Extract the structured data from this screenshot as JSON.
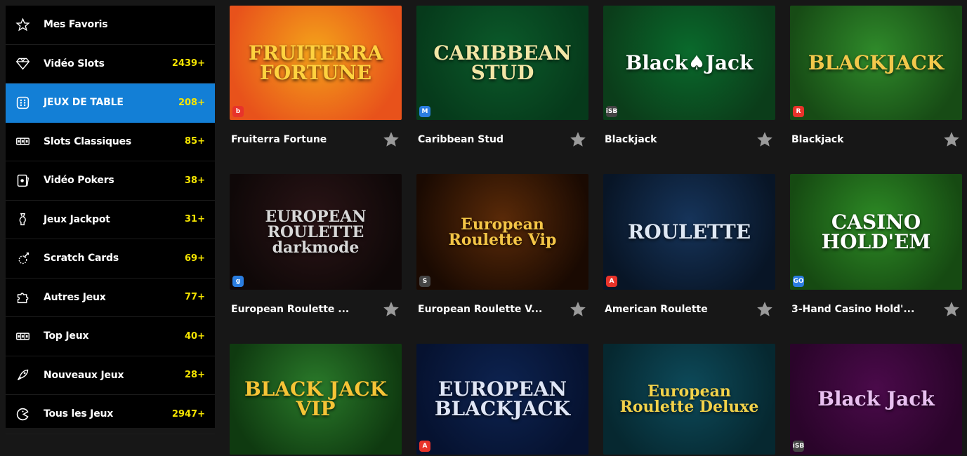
{
  "sidebar": {
    "items": [
      {
        "icon": "star-outline-icon",
        "label": "Mes Favoris",
        "count": ""
      },
      {
        "icon": "diamond-icon",
        "label": "Vidéo Slots",
        "count": "2439+"
      },
      {
        "icon": "dice-icon",
        "label": "JEUX DE TABLE",
        "count": "208+",
        "active": true
      },
      {
        "icon": "slot-reels-icon",
        "label": "Slots Classiques",
        "count": "85+"
      },
      {
        "icon": "poker-card-icon",
        "label": "Vidéo Pokers",
        "count": "38+"
      },
      {
        "icon": "jackpot-icon",
        "label": "Jeux Jackpot",
        "count": "31+"
      },
      {
        "icon": "scratch-card-icon",
        "label": "Scratch Cards",
        "count": "69+"
      },
      {
        "icon": "puzzle-icon",
        "label": "Autres Jeux",
        "count": "77+"
      },
      {
        "icon": "slot-reels-icon",
        "label": "Top Jeux",
        "count": "40+"
      },
      {
        "icon": "rocket-icon",
        "label": "Nouveaux Jeux",
        "count": "28+"
      },
      {
        "icon": "pacman-icon",
        "label": "Tous les Jeux",
        "count": "2947+"
      }
    ]
  },
  "games": [
    {
      "title": "Fruiterra Fortune",
      "art": "FRUITERRA FORTUNE",
      "provider": "b",
      "colors": [
        "#f4a21a",
        "#e8521b"
      ],
      "artColor": "#ffd23f"
    },
    {
      "title": "Caribbean Stud",
      "art": "CARIBBEAN STUD",
      "provider": "M",
      "colors": [
        "#0b5a2a",
        "#063a1b"
      ],
      "artColor": "#f3e6a6"
    },
    {
      "title": "Blackjack",
      "art": "Black♠Jack",
      "provider": "iSB",
      "colors": [
        "#0a6a2c",
        "#0b3d1a"
      ],
      "artColor": "#ffffff"
    },
    {
      "title": "Blackjack",
      "art": "BLACKJACK",
      "provider": "R",
      "colors": [
        "#2f8a2a",
        "#174b15"
      ],
      "artColor": "#f2c84b"
    },
    {
      "title": "European Roulette ...",
      "art": "EUROPEAN ROULETTE darkmode",
      "provider": "g",
      "colors": [
        "#2a1416",
        "#0f0808"
      ],
      "artColor": "#d8d8d8"
    },
    {
      "title": "European Roulette V...",
      "art": "European Roulette Vip",
      "provider": "S",
      "colors": [
        "#5a2a08",
        "#1a0a02"
      ],
      "artColor": "#f3c546"
    },
    {
      "title": "American Roulette",
      "art": "ROULETTE",
      "provider": "A",
      "colors": [
        "#16345a",
        "#081526"
      ],
      "artColor": "#dfe8f4"
    },
    {
      "title": "3-Hand Casino Hold'...",
      "art": "CASINO HOLD'EM",
      "provider": "GO",
      "colors": [
        "#2d8a25",
        "#164a12"
      ],
      "artColor": "#ffffff"
    },
    {
      "title": "",
      "art": "BLACK JACK VIP",
      "provider": "",
      "colors": [
        "#2a7a2a",
        "#0f3a10"
      ],
      "artColor": "#f6c436"
    },
    {
      "title": "",
      "art": "EUROPEAN BLACKJACK",
      "provider": "A",
      "colors": [
        "#0d2350",
        "#061230"
      ],
      "artColor": "#dfe6f6"
    },
    {
      "title": "",
      "art": "European Roulette Deluxe",
      "provider": "",
      "colors": [
        "#0d4a5a",
        "#062830"
      ],
      "artColor": "#f2d24a"
    },
    {
      "title": "",
      "art": "Black Jack",
      "provider": "iSB",
      "colors": [
        "#4a0a4a",
        "#2a042a"
      ],
      "artColor": "#e8c0f0"
    }
  ]
}
